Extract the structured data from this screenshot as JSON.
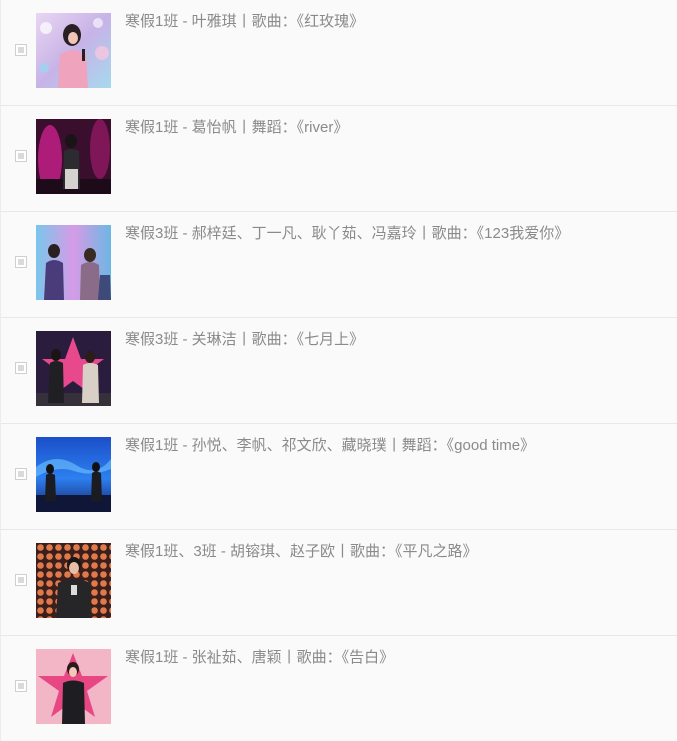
{
  "items": [
    {
      "title": "寒假1班 - 叶雅琪丨歌曲：《红玫瑰》",
      "photo": "singer-pink-bokeh"
    },
    {
      "title": "寒假1班 - 葛怡帆丨舞蹈：《river》",
      "photo": "dancer-magenta-stage"
    },
    {
      "title": "寒假3班 - 郝梓廷、丁一凡、耿丫茹、冯嘉玲丨歌曲：《123我爱你》",
      "photo": "group-singers-blue-pink"
    },
    {
      "title": "寒假3班 - 关琳洁丨歌曲：《七月上》",
      "photo": "duo-star-backdrop"
    },
    {
      "title": "寒假1班 - 孙悦、李帆、祁文欣、藏晓璞丨舞蹈：《good time》",
      "photo": "dancers-blue-wave"
    },
    {
      "title": "寒假1班、3班 - 胡镕琪、赵子欧丨歌曲：《平凡之路》",
      "photo": "singer-orange-dots"
    },
    {
      "title": "寒假1班 - 张祉茹、唐颖丨歌曲：《告白》",
      "photo": "singer-pink-star"
    }
  ]
}
